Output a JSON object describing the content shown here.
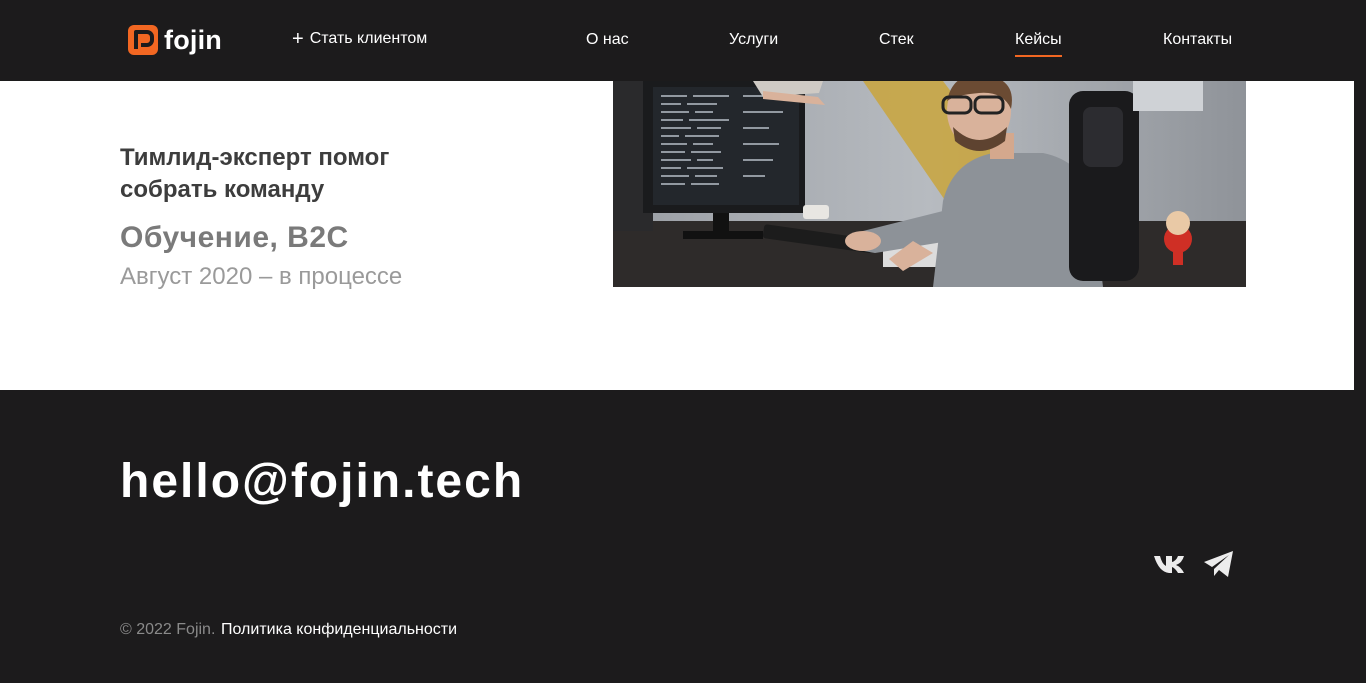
{
  "header": {
    "logo_text": "fojin",
    "cta_plus": "+",
    "cta_label": "Стать клиентом",
    "nav": [
      {
        "label": "О нас"
      },
      {
        "label": "Услуги"
      },
      {
        "label": "Стек"
      },
      {
        "label": "Кейсы",
        "active": true
      },
      {
        "label": "Контакты"
      }
    ]
  },
  "case": {
    "title": "Тимлид-эксперт помог собрать команду",
    "category": "Обучение, B2C",
    "date": "Август 2020 – в процессе"
  },
  "footer": {
    "email": "hello@fojin.tech",
    "social": [
      {
        "icon": "vk-icon"
      },
      {
        "icon": "telegram-icon"
      }
    ],
    "copyright": "© 2022 Fojin.",
    "privacy_label": "Политика конфиденциальности"
  },
  "colors": {
    "background_dark": "#1c1b1c",
    "accent": "#f26722",
    "section_light": "#ffffff"
  }
}
